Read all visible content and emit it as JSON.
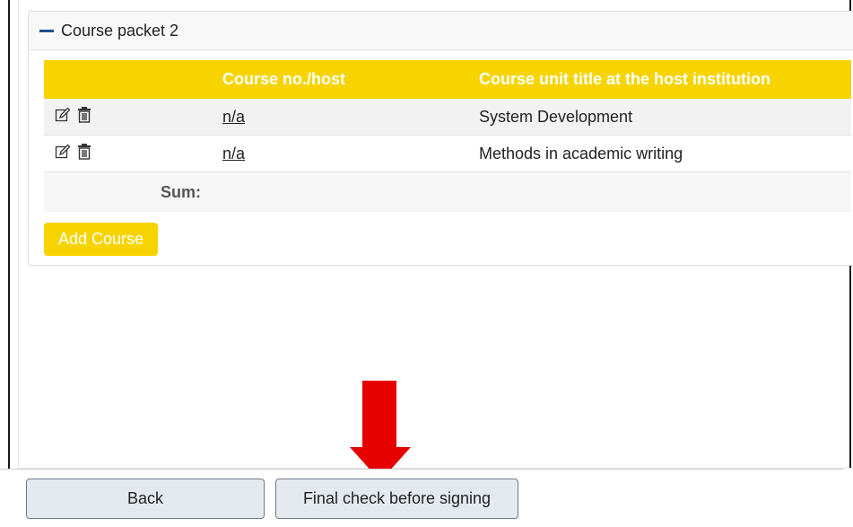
{
  "packet": {
    "title": "Course packet 2",
    "columns": [
      "",
      "Course no./host",
      "Course unit title at the host institution"
    ],
    "rows": [
      {
        "course_no": "n/a",
        "title": "System Development"
      },
      {
        "course_no": "n/a",
        "title": "Methods in academic writing"
      }
    ],
    "sum_label": "Sum:",
    "add_button": "Add Course"
  },
  "footer": {
    "back_label": "Back",
    "final_check_label": "Final check before signing"
  },
  "icons": {
    "collapse": "minus-icon",
    "edit": "edit-icon",
    "delete": "trash-icon",
    "annotation": "down-arrow-icon"
  },
  "colors": {
    "accent_yellow": "#f7d400",
    "collapse_blue": "#1f4e8c",
    "arrow_red": "#e60000"
  }
}
